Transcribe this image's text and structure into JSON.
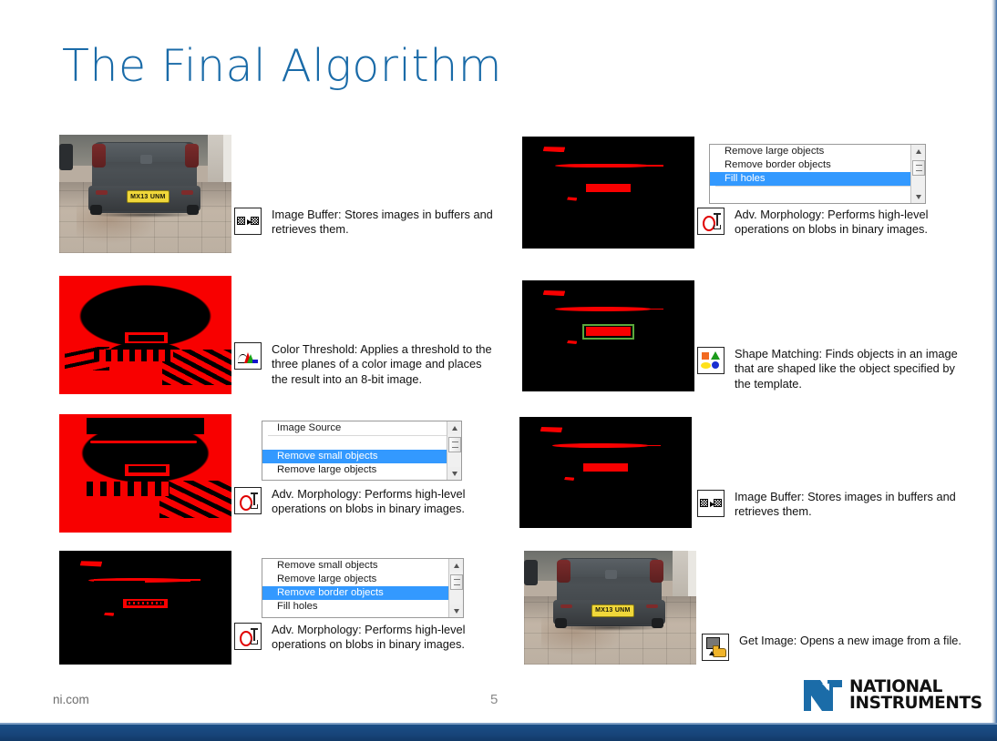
{
  "slide": {
    "title": "The Final Algorithm",
    "page_number": "5",
    "footer_url": "ni.com",
    "accent_color": "#1a6ba8",
    "blob_color": "#f80000",
    "selection_color": "#3399ff"
  },
  "logo": {
    "line1": "NATIONAL",
    "line2": "INSTRUMENTS",
    "trademark": "™",
    "mark_color": "#1b6ca8"
  },
  "plate": {
    "text": "MX13 UNM"
  },
  "steps": [
    {
      "id": "image-buffer-1",
      "icon": "image-buffer-icon",
      "text": "Image Buffer:  Stores images in buffers and retrieves them."
    },
    {
      "id": "color-threshold",
      "icon": "color-threshold-icon",
      "text": "Color Threshold:  Applies a threshold to the three planes of a color image and places the result into an 8-bit image."
    },
    {
      "id": "adv-morphology-1",
      "icon": "adv-morphology-icon",
      "text": "Adv. Morphology:  Performs high-level operations on blobs in binary images."
    },
    {
      "id": "adv-morphology-2",
      "icon": "adv-morphology-icon",
      "text": "Adv. Morphology:  Performs high-level operations on blobs in binary images."
    },
    {
      "id": "adv-morphology-3",
      "icon": "adv-morphology-icon",
      "text": "Adv. Morphology:  Performs high-level operations on blobs in binary images."
    },
    {
      "id": "shape-matching",
      "icon": "shape-matching-icon",
      "text": "Shape Matching:  Finds objects in an image that are shaped like the object specified by the template."
    },
    {
      "id": "image-buffer-2",
      "icon": "image-buffer-icon",
      "text": "Image Buffer:  Stores images in buffers and retrieves them."
    },
    {
      "id": "get-image",
      "icon": "get-image-icon",
      "text": "Get Image:  Opens a new image from a file."
    }
  ],
  "listboxes": {
    "remove_small": {
      "name": "adv-morphology-listbox-remove-small-objects",
      "items": [
        {
          "label": "Image Source",
          "selected": false
        },
        {
          "label": "",
          "selected": false
        },
        {
          "label": "Remove small objects",
          "selected": true
        },
        {
          "label": "Remove large objects",
          "selected": false
        }
      ]
    },
    "remove_border": {
      "name": "adv-morphology-listbox-remove-border-objects",
      "items": [
        {
          "label": "Remove small objects",
          "selected": false
        },
        {
          "label": "Remove large objects",
          "selected": false
        },
        {
          "label": "Remove border objects",
          "selected": true
        },
        {
          "label": "Fill holes",
          "selected": false
        }
      ]
    },
    "fill_holes": {
      "name": "adv-morphology-listbox-fill-holes",
      "items": [
        {
          "label": "Remove large objects",
          "selected": false
        },
        {
          "label": "Remove border objects",
          "selected": false
        },
        {
          "label": "Fill holes",
          "selected": true
        },
        {
          "label": "",
          "selected": false
        }
      ]
    }
  },
  "images": [
    {
      "id": "source-photo-top-left",
      "type": "photo",
      "caption": "rear view of dark grey hatchback with yellow number plate on block paving"
    },
    {
      "id": "color-threshold-result",
      "type": "binary-dense",
      "caption": "binary image, red thresholded pixels, car body black"
    },
    {
      "id": "remove-small-objects-result",
      "type": "binary-dense",
      "caption": "binary image after removing small objects"
    },
    {
      "id": "remove-border-objects-result",
      "type": "binary-blobs",
      "caption": "black image with four red blobs including plate outline"
    },
    {
      "id": "fill-holes-result",
      "type": "binary-blobs-filled",
      "caption": "black image with red blobs, plate filled solid"
    },
    {
      "id": "shape-matching-result",
      "type": "binary-blobs-matched",
      "caption": "plate blob highlighted with green bounding rectangle"
    },
    {
      "id": "image-buffer-result",
      "type": "binary-blobs-filled",
      "caption": "black image with red blobs"
    },
    {
      "id": "source-photo-bottom-right",
      "type": "photo",
      "caption": "original colour photo of car rear"
    }
  ]
}
